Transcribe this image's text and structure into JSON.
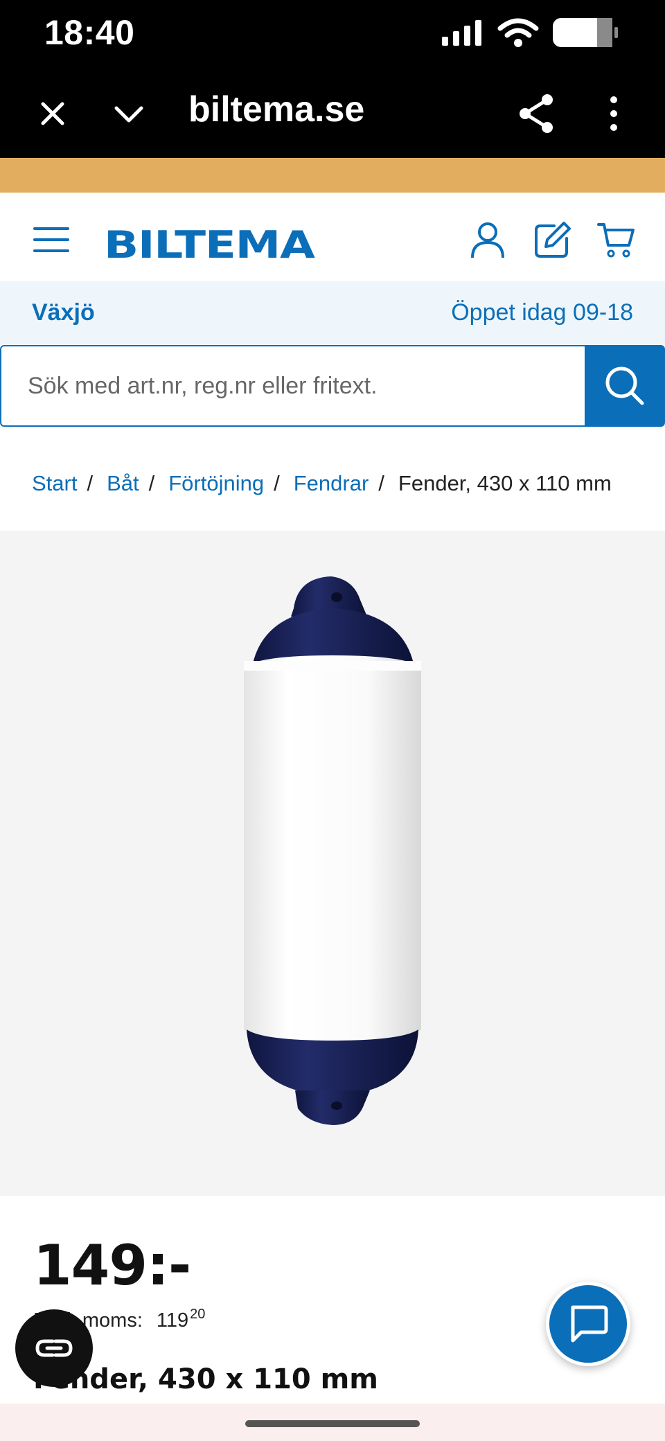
{
  "status_bar": {
    "time": "18:40"
  },
  "browser": {
    "domain": "biltema.se"
  },
  "site": {
    "logo_text": "BILTEMA"
  },
  "store": {
    "name": "Växjö",
    "hours": "Öppet idag 09-18"
  },
  "search": {
    "placeholder": "Sök med art.nr, reg.nr eller fritext.",
    "value": ""
  },
  "breadcrumb": {
    "items": [
      "Start",
      "Båt",
      "Förtöjning",
      "Fendrar"
    ],
    "current": "Fender, 430 x 110 mm"
  },
  "product": {
    "price": "149:-",
    "excl_vat_label": "Exkl. moms:",
    "excl_vat_main": "119",
    "excl_vat_decimals": "20",
    "title": "Fender, 430 x 110 mm"
  },
  "colors": {
    "brand_blue": "#0b6eb8",
    "promo": "#e2ad5e",
    "fender_cap": "#1a2256"
  },
  "icons": [
    "close-icon",
    "chevron-down-icon",
    "share-icon",
    "more-icon",
    "menu-icon",
    "user-icon",
    "edit-icon",
    "cart-icon",
    "search-icon",
    "chat-icon",
    "reader-icon"
  ]
}
